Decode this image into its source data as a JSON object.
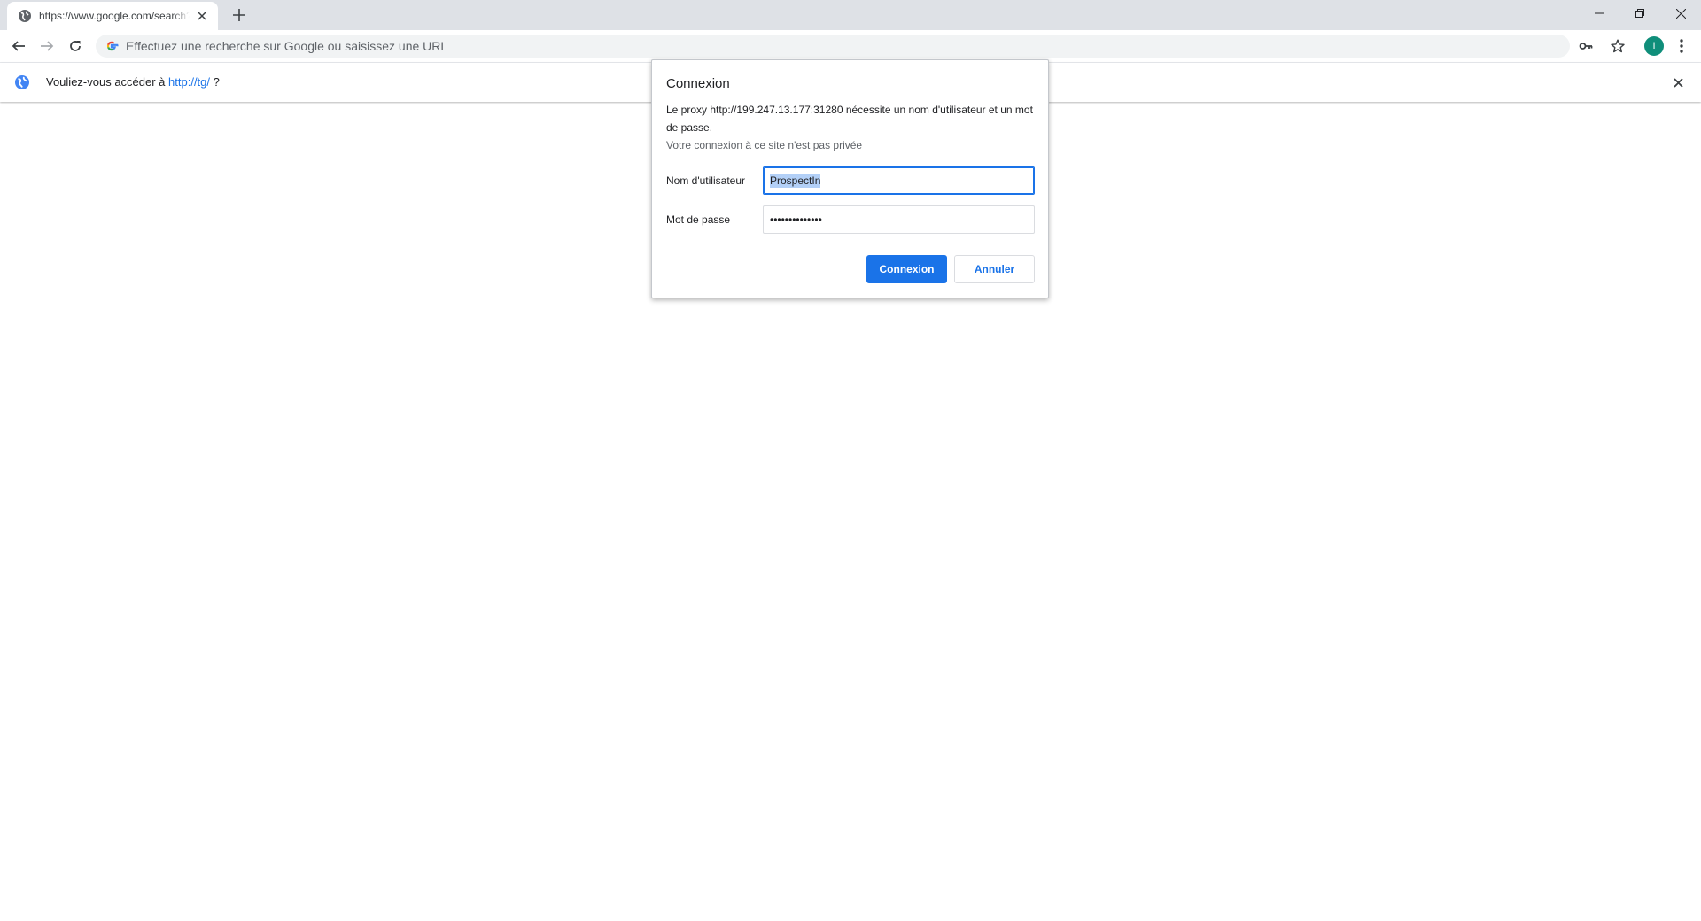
{
  "tab": {
    "title": "https://www.google.com/search?",
    "favicon": "globe-icon"
  },
  "toolbar": {
    "omnibox_placeholder": "Effectuez une recherche sur Google ou saisissez une URL",
    "avatar_initial": "I",
    "avatar_color": "#0f8e7a"
  },
  "infobar": {
    "prefix": "Vouliez-vous accéder à ",
    "link": "http://tg/",
    "suffix": " ?"
  },
  "dialog": {
    "title": "Connexion",
    "message": "Le proxy http://199.247.13.177:31280 nécessite un nom d'utilisateur et un mot de passe.",
    "subtext": "Votre connexion à ce site n'est pas privée",
    "username_label": "Nom d'utilisateur",
    "username_value": "ProspectIn",
    "password_label": "Mot de passe",
    "password_value": "••••••••••••••",
    "connect_button": "Connexion",
    "cancel_button": "Annuler"
  },
  "colors": {
    "accent": "#1a73e8",
    "tabstrip": "#dee1e6",
    "omnibox": "#f1f3f4"
  }
}
